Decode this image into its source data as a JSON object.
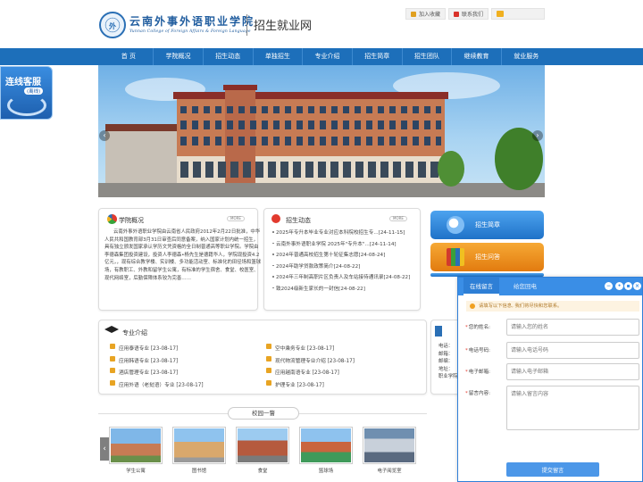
{
  "header": {
    "logo_emblem": "外",
    "school_name_cn": "云南外事外语职业学院",
    "school_name_en": "Yunnan College of Foreign Affairs & Foreign Language",
    "site_title": "招生就业网",
    "top_links": {
      "favorite": "加入收藏",
      "contact": "联系我们"
    }
  },
  "nav": {
    "items": [
      "首 页",
      "学院概况",
      "招生动态",
      "单独招生",
      "专业介绍",
      "招生简章",
      "招生团队",
      "继续教育",
      "就业服务"
    ]
  },
  "left_float": {
    "title": "连线客服",
    "sub": "(离线)"
  },
  "intro": {
    "title": "学院概况",
    "more": "MORE",
    "text": "云南外事外语职业学院由云南省人民政府2012年2月22日批准，中华人民共和国教育部3月31日审查后同意备案，纳入国家计划内统一招生，具有独立颁发国家承认学历文凭资格的全日制普通高等职业学院。学院由李德森集团投资建设，投资人李德森•杨先生是德籍华人，学院现投资4.2亿元，，现有综合教学楼、实训楼、多功能活动室、标准化的田径场和篮球场，有教职工、外教和留学生公寓，有标准的学生宿舍、食堂、校医室、现代网络室，后勤保障体系较为完善……"
  },
  "news": {
    "title": "招生动态",
    "more": "MORE",
    "items": [
      "2025年专升本毕业专业对应本科院校招生专...[24-11-15]",
      "云南外事外语职业学院 2025年\"专升本\"...[24-11-14]",
      "2024年普通高校招生第十轮征集志愿[24-08-24]",
      "2024年助学贷款政策简介[24-08-22]",
      "2024年三年制高职片区负责人及车站接待通讯录[24-08-22]",
      "致2024级新生家长的一封信[24-08-22]"
    ]
  },
  "side_buttons": {
    "brochure": "招生简章",
    "qa": "招生问答"
  },
  "majors": {
    "title": "专业介绍",
    "items": [
      "应用泰语专业 [23-08-17]",
      "空中乘务专业 [23-08-17]",
      "应用韩语专业 [23-08-17]",
      "现代物流管理专业介绍 [23-08-17]",
      "酒店管理专业 [23-08-17]",
      "应用越南语专业 [23-08-17]",
      "应用外语（老挝语）专业 [23-08-17]",
      "护理专业 [23-08-17]"
    ]
  },
  "campus": {
    "title": "校园一瞥",
    "items": [
      "学生公寓",
      "图书馆",
      "食堂",
      "篮球场",
      "电子阅览室"
    ]
  },
  "contact_partial": [
    "电话：",
    "邮箱：",
    "邮编：",
    "地址：",
    "职业学院"
  ],
  "message_widget": {
    "tab_active": "在线留言",
    "tab_other": "给您回电",
    "notice": "请填写以下信息, 我们将尽快和您联系。",
    "fields": {
      "name_label": "您的姓名:",
      "name_placeholder": "请输入您的姓名",
      "phone_label": "电话号码:",
      "phone_placeholder": "请输入电话号码",
      "email_label": "电子邮箱:",
      "email_placeholder": "请输入电子邮箱",
      "message_label": "留言内容:",
      "message_placeholder": "请输入留言内容"
    },
    "submit": "提交留言"
  }
}
